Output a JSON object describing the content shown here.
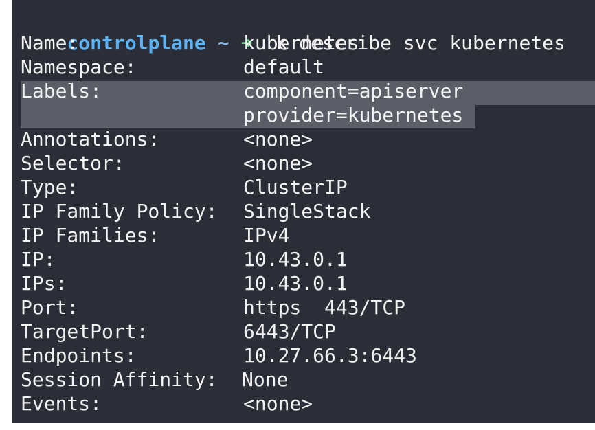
{
  "prompt": {
    "host": "controlplane",
    "tilde": "~",
    "arrow": "➜",
    "command": "k describe svc kubernetes"
  },
  "output": {
    "name": {
      "label": "Name:",
      "value": "kubernetes"
    },
    "namespace": {
      "label": "Namespace:",
      "value": "default"
    },
    "labels": {
      "label": "Labels:",
      "value": "component=apiserver"
    },
    "labels_2": {
      "value": "provider=kubernetes"
    },
    "annotations": {
      "label": "Annotations:",
      "value": "<none>"
    },
    "selector": {
      "label": "Selector:",
      "value": "<none>"
    },
    "type": {
      "label": "Type:",
      "value": "ClusterIP"
    },
    "ip_family_policy": {
      "label": "IP Family Policy:",
      "value": "SingleStack"
    },
    "ip_families": {
      "label": "IP Families:",
      "value": "IPv4"
    },
    "ip": {
      "label": "IP:",
      "value": "10.43.0.1"
    },
    "ips": {
      "label": "IPs:",
      "value": "10.43.0.1"
    },
    "port": {
      "label": "Port:",
      "value": "https  443/TCP"
    },
    "target_port": {
      "label": "TargetPort:",
      "value": "6443/TCP"
    },
    "endpoints": {
      "label": "Endpoints:",
      "value": "10.27.66.3:6443"
    },
    "session_affinity": {
      "label": "Session Affinity:",
      "value": "None"
    },
    "events": {
      "label": "Events:",
      "value": "<none>"
    }
  },
  "colors": {
    "background": "#2b2e37",
    "text": "#f2f2f2",
    "prompt_host": "#5ab3f6",
    "prompt_arrow": "#6ee08c",
    "selection": "#5b5e66"
  }
}
